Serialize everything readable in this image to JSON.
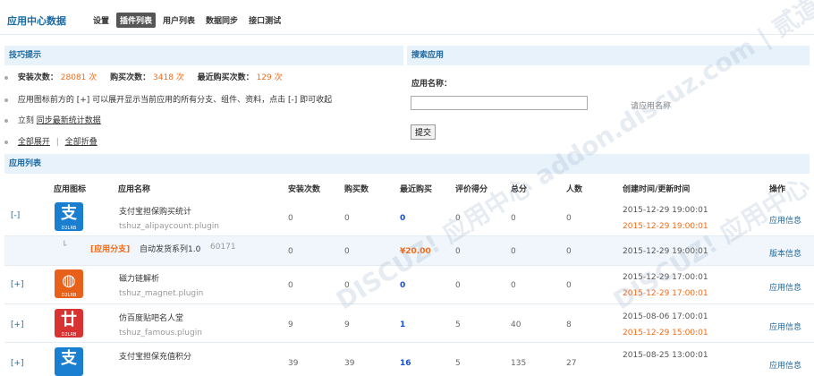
{
  "header": {
    "title": "应用中心数据",
    "nav": [
      "设置",
      "插件列表",
      "用户列表",
      "数据同步",
      "接口测试"
    ],
    "active_index": 1
  },
  "tips_panel": {
    "title": "技巧提示",
    "stats": [
      {
        "label": "安装次数：",
        "value": "28081 次"
      },
      {
        "label": "购买次数：",
        "value": "3418 次"
      },
      {
        "label": "最近购买次数：",
        "value": "129 次"
      }
    ],
    "tip2": "应用图标前方的 [+] 可以展开显示当前应用的所有分支、组件、资料，点击 [-] 即可收起",
    "tip3_prefix": "立刻",
    "tip3_link": "同步最新统计数据",
    "tip4_expand": "全部展开",
    "tip4_sep": "|",
    "tip4_collapse": "全部折叠"
  },
  "search_panel": {
    "title": "搜索应用",
    "label": "应用名称：",
    "value": "",
    "hint": "请应用名称",
    "submit": "提交"
  },
  "list": {
    "title": "应用列表",
    "columns": [
      "应用图标",
      "应用名称",
      "安装次数",
      "购买数",
      "最近购买",
      "评价得分",
      "总分",
      "人数",
      "创建时间/更新时间",
      "操作"
    ],
    "rows": [
      {
        "expander": "[-]",
        "icon": "alipay-icon",
        "icon_color": "#1a7fd0",
        "icon_glyph": "支",
        "icon_caption": "D2LRB",
        "name": "支付宝担保购买统计",
        "id": "tshuz_alipaycount.plugin",
        "installs": "0",
        "buys": "0",
        "recent": "0",
        "rating": "0",
        "total": "0",
        "people": "0",
        "created": "2015-12-29 19:00:01",
        "updated": "2015-12-29 19:00:01",
        "action": "应用信息"
      },
      {
        "sub": true,
        "tag": "[应用分支]",
        "name": "自动发货系列1.0",
        "ver": "60171",
        "installs": "0",
        "buys": "0",
        "recent": "¥20.00",
        "rating": "0",
        "total": "0",
        "people": "0",
        "created": "2015-12-29 19:00:01",
        "action": "版本信息"
      },
      {
        "expander": "[+]",
        "icon": "magnet-icon",
        "icon_color": "#e8611a",
        "icon_glyph": "◍",
        "icon_caption": "D2LRB",
        "name": "磁力链解析",
        "id": "tshuz_magnet.plugin",
        "installs": "0",
        "buys": "0",
        "recent": "0",
        "rating": "0",
        "total": "0",
        "people": "0",
        "created": "2015-12-29 17:00:01",
        "updated": "2015-12-29 17:00:01",
        "action": "应用信息"
      },
      {
        "expander": "[+]",
        "icon": "famous-icon",
        "icon_color": "#d83232",
        "icon_glyph": "廿",
        "icon_caption": "D2LRB",
        "name": "仿百度贴吧名人堂",
        "id": "tshuz_famous.plugin",
        "installs": "9",
        "buys": "9",
        "recent": "1",
        "rating": "5",
        "total": "40",
        "people": "8",
        "created": "2015-08-06 17:00:01",
        "updated": "2015-12-29 15:00:01",
        "action": "应用信息"
      },
      {
        "expander": "[+]",
        "icon": "alipay-icon",
        "icon_color": "#1a7fd0",
        "icon_glyph": "支",
        "icon_caption": "D2LRB",
        "name": "支付宝担保充值积分",
        "id": "",
        "installs": "39",
        "buys": "39",
        "recent": "16",
        "rating": "5",
        "total": "135",
        "people": "27",
        "created": "2015-08-25 13:00:01",
        "updated": "",
        "action": "应用信息"
      }
    ]
  },
  "watermark": "DISCUZ! 应用中心 addon.discuz.com | 贰道"
}
